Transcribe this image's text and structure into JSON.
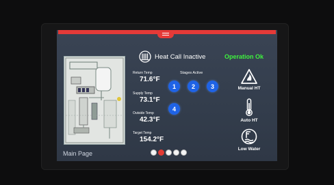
{
  "header": {
    "heat_title": "Heat Call Inactive",
    "status": "Operation Ok"
  },
  "temps": [
    {
      "label": "Return Temp",
      "value": "71.6°F"
    },
    {
      "label": "Supply Temp",
      "value": "73.1°F"
    },
    {
      "label": "Outside Temp",
      "value": "42.3°F"
    },
    {
      "label": "Target Temp",
      "value": "154.2°F"
    }
  ],
  "stages": {
    "label": "Stages Active",
    "items": [
      "1",
      "2",
      "3",
      "4"
    ]
  },
  "actions": {
    "manual_ht": "Manual HT",
    "auto_ht": "Auto HT",
    "low_water": "Low Water"
  },
  "footer": {
    "page_label": "Main Page",
    "pages": 5,
    "current_page": 2
  },
  "colors": {
    "top_bar": "#e53a38",
    "status_ok": "#3ef23e",
    "stage_circle": "#1f63e6",
    "screen_bg": "#37404f"
  },
  "icons": [
    "heating-coil-icon",
    "warning-triangle-icon",
    "thermometer-icon",
    "low-water-icon"
  ]
}
